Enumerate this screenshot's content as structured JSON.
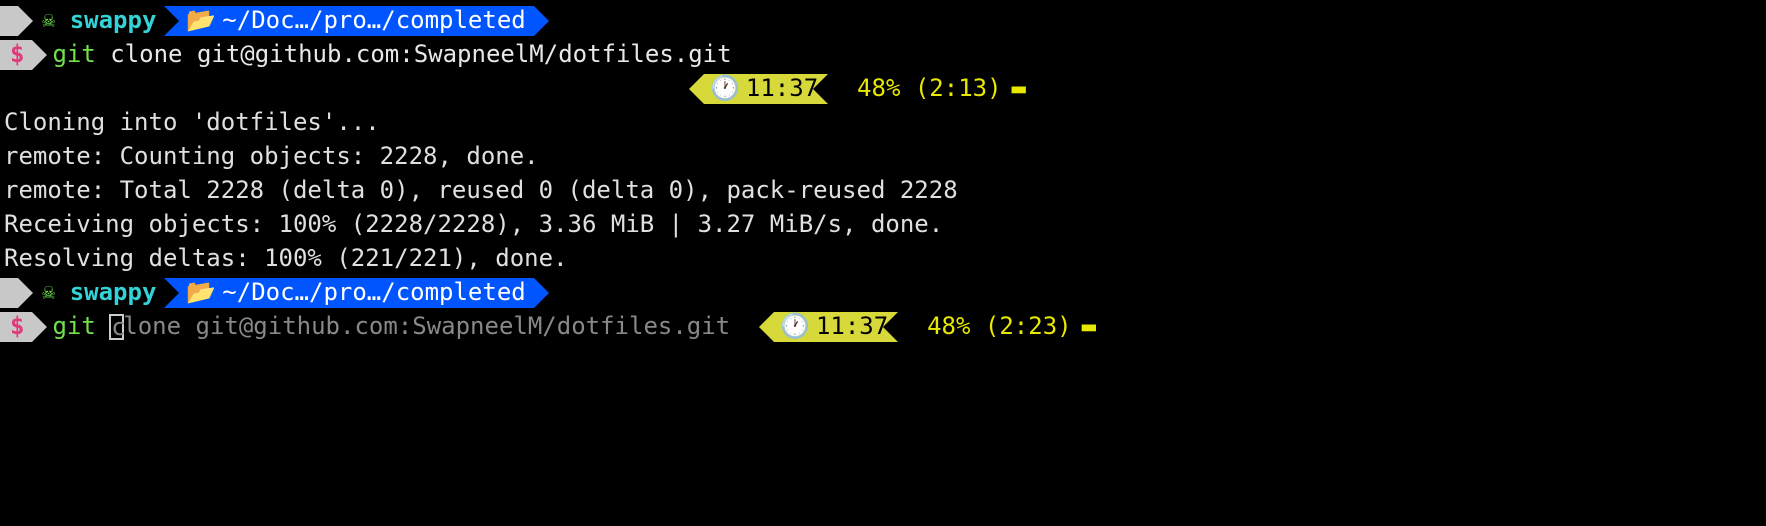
{
  "prompt1": {
    "user": "swappy",
    "path": "~/Doc…/pro…/completed",
    "symbol": "$",
    "cmd_git": "git",
    "cmd_rest": " clone git@github.com:SwapneelM/dotfiles.git"
  },
  "status1": {
    "time": "11:37",
    "battery": "48% (2:13)"
  },
  "output": {
    "l1": "Cloning into 'dotfiles'...",
    "l2": "remote: Counting objects: 2228, done.",
    "l3": "remote: Total 2228 (delta 0), reused 0 (delta 0), pack-reused 2228",
    "l4": "Receiving objects: 100% (2228/2228), 3.36 MiB | 3.27 MiB/s, done.",
    "l5": "Resolving deltas: 100% (221/221), done."
  },
  "prompt2": {
    "user": "swappy",
    "path": "~/Doc…/pro…/completed",
    "symbol": "$",
    "cmd_git": "git",
    "cursor_char": "c",
    "cmd_after": "lone git@github.com:SwapneelM/dotfiles.git"
  },
  "status2": {
    "time": "11:37",
    "battery": "48% (2:23)"
  }
}
